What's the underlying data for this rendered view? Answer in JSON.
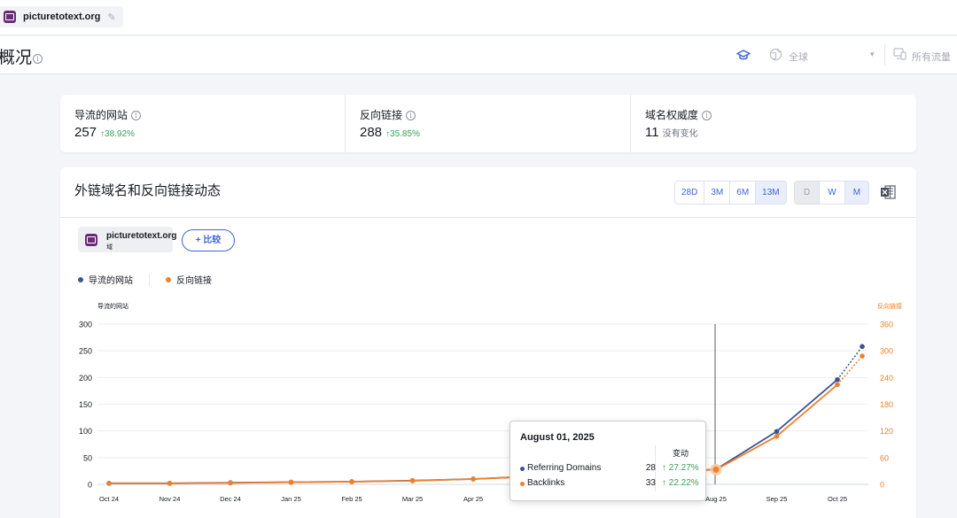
{
  "project": {
    "domain": "picturetotext.org"
  },
  "header": {
    "title": "概况",
    "region": "全球",
    "traffic": "所有流量"
  },
  "kpis": [
    {
      "label": "导流的网站",
      "value": "257",
      "change": "↑38.92%"
    },
    {
      "label": "反向链接",
      "value": "288",
      "change": "↑35.85%"
    },
    {
      "label": "域名权威度",
      "value": "11",
      "change": "没有变化"
    }
  ],
  "chart_section": {
    "title": "外链域名和反向链接动态",
    "ranges": [
      "28D",
      "3M",
      "6M",
      "13M"
    ],
    "active_range": "13M",
    "granularity": [
      "D",
      "W",
      "M"
    ],
    "active_granularity": "M",
    "entity": {
      "name": "picturetotext.org",
      "type": "域"
    },
    "compare_label": "+ 比较"
  },
  "chart_data": {
    "type": "line",
    "x": [
      "Oct 24",
      "Nov 24",
      "Dec 24",
      "Jan 25",
      "Feb 25",
      "Mar 25",
      "Apr 25",
      "May 25",
      "Jun 25",
      "Jul 25",
      "Aug 25",
      "Sep 25",
      "Oct 25"
    ],
    "x_labels": [
      "Oct 24",
      "Nov 24",
      "Dec 24",
      "Jan 25",
      "Feb 25",
      "Mar 25",
      "Apr 25",
      "",
      "",
      "",
      "Aug 25",
      "Sep 25",
      "Oct 25"
    ],
    "x_extra": "Oct 25",
    "series": [
      {
        "name": "导流的网站",
        "axis": "left",
        "color": "#3c5494",
        "values": [
          2,
          2,
          3,
          4,
          5,
          7,
          10,
          15,
          20,
          22,
          28,
          99,
          196
        ],
        "projected": 258
      },
      {
        "name": "反向链接",
        "axis": "right",
        "color": "#f08029",
        "values": [
          2,
          2,
          3,
          5,
          6,
          8,
          12,
          18,
          24,
          27,
          33,
          108,
          224
        ],
        "projected": 288
      }
    ],
    "left_axis": {
      "title": "导流的网站",
      "ticks": [
        0,
        50,
        100,
        150,
        200,
        250,
        300
      ],
      "ylim": [
        0,
        300
      ]
    },
    "right_axis": {
      "title": "反向链接",
      "ticks": [
        0,
        60,
        120,
        180,
        240,
        300,
        360
      ],
      "ylim": [
        0,
        360
      ]
    },
    "hover_index": 10,
    "grid": true
  },
  "tooltip": {
    "date": "August 01, 2025",
    "change_header": "变动",
    "rows": [
      {
        "name": "Referring Domains",
        "value": "28",
        "change": "↑ 27.27%",
        "color": "#3c5494"
      },
      {
        "name": "Backlinks",
        "value": "33",
        "change": "↑ 22.22%",
        "color": "#f08029"
      }
    ]
  }
}
